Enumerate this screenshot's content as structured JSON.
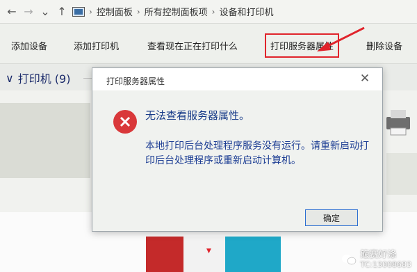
{
  "address": {
    "back": "←",
    "forward": "→",
    "sep": "›",
    "breadcrumbs": [
      "控制面板",
      "所有控制面板项",
      "设备和打印机"
    ]
  },
  "toolbar": {
    "add_device": "添加设备",
    "add_printer": "添加打印机",
    "see_printing": "查看现在正在打印什么",
    "print_server_props": "打印服务器属性",
    "remove_device": "删除设备"
  },
  "group": {
    "label": "打印机 (9)",
    "chevron": "∨"
  },
  "dialog": {
    "title": "打印服务器属性",
    "close": "✕",
    "heading": "无法查看服务器属性。",
    "body": "本地打印后台处理程序服务没有运行。请重新启动打印后台处理程序或重新启动计算机。",
    "ok_label": "确定",
    "error_color": "#d9383a",
    "text_color": "#1d3e94"
  },
  "watermark": {
    "text": "簸赛好涤",
    "sub": "TC:13008683"
  },
  "accent": "#e0242c"
}
